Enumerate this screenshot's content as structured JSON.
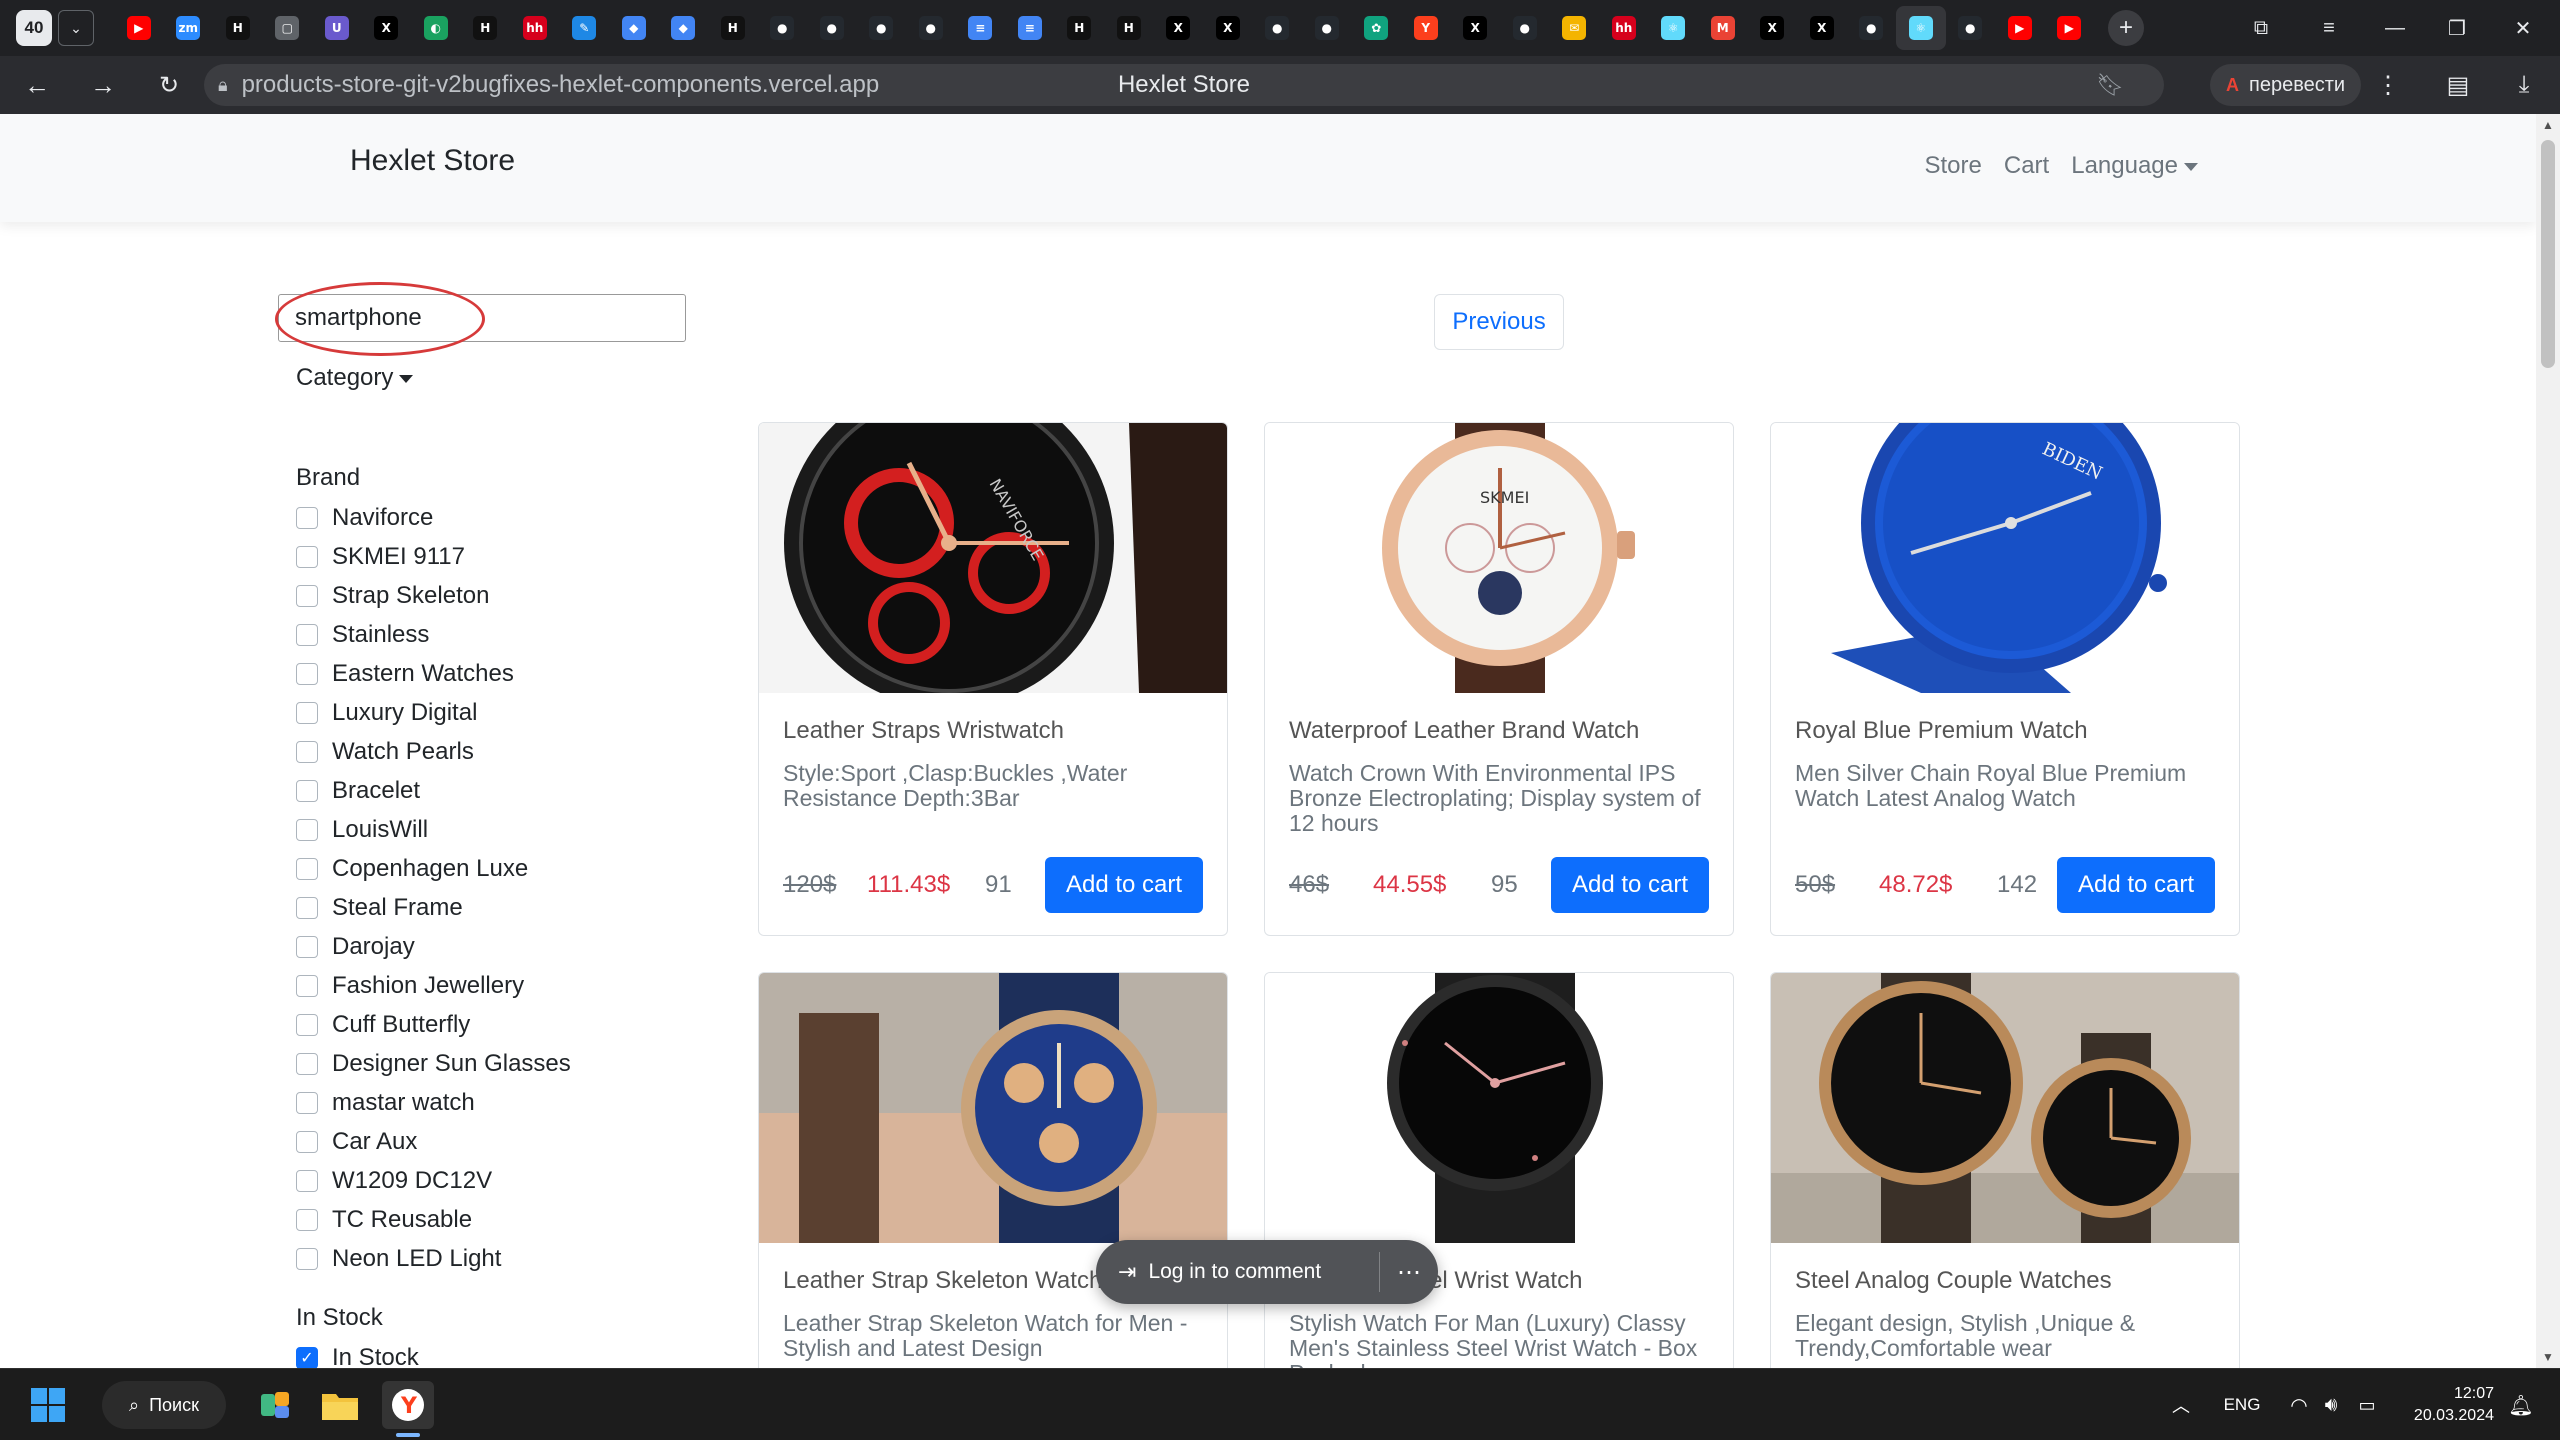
{
  "browser": {
    "tab_count": "40",
    "tabs": [
      {
        "icon": "youtube-icon",
        "glyph": "▶",
        "color": "#ff0000"
      },
      {
        "icon": "zoom-icon",
        "glyph": "zm",
        "color": "#2d8cff"
      },
      {
        "icon": "hexlet-icon",
        "glyph": "H",
        "color": "#111111"
      },
      {
        "icon": "document-icon",
        "glyph": "▢",
        "color": "#5f6368"
      },
      {
        "icon": "uchi-icon",
        "glyph": "U",
        "color": "#6a5acd"
      },
      {
        "icon": "x-icon",
        "glyph": "X",
        "color": "#000000"
      },
      {
        "icon": "green-bird-icon",
        "glyph": "◐",
        "color": "#1aa260"
      },
      {
        "icon": "hexlet-icon",
        "glyph": "H",
        "color": "#111111"
      },
      {
        "icon": "hh-icon",
        "glyph": "hh",
        "color": "#d6001c"
      },
      {
        "icon": "feather-icon",
        "glyph": "✎",
        "color": "#1e88e5"
      },
      {
        "icon": "cube-icon",
        "glyph": "◆",
        "color": "#4285f4"
      },
      {
        "icon": "cube-icon",
        "glyph": "◆",
        "color": "#4285f4"
      },
      {
        "icon": "hexlet-icon",
        "glyph": "H",
        "color": "#111111"
      },
      {
        "icon": "github-icon",
        "glyph": "●",
        "color": "#24292f"
      },
      {
        "icon": "github-icon",
        "glyph": "●",
        "color": "#24292f"
      },
      {
        "icon": "github-icon",
        "glyph": "●",
        "color": "#24292f"
      },
      {
        "icon": "github-icon",
        "glyph": "●",
        "color": "#24292f"
      },
      {
        "icon": "docs-icon",
        "glyph": "≡",
        "color": "#4285f4"
      },
      {
        "icon": "docs-icon",
        "glyph": "≡",
        "color": "#4285f4"
      },
      {
        "icon": "hexlet-icon",
        "glyph": "H",
        "color": "#111111"
      },
      {
        "icon": "hexlet-icon",
        "glyph": "H",
        "color": "#111111"
      },
      {
        "icon": "x-icon",
        "glyph": "X",
        "color": "#000000"
      },
      {
        "icon": "x-icon",
        "glyph": "X",
        "color": "#000000"
      },
      {
        "icon": "github-icon",
        "glyph": "●",
        "color": "#24292f"
      },
      {
        "icon": "github-icon",
        "glyph": "●",
        "color": "#24292f"
      },
      {
        "icon": "chatgpt-icon",
        "glyph": "✿",
        "color": "#10a37f"
      },
      {
        "icon": "yandex-icon",
        "glyph": "Y",
        "color": "#fc3f1d"
      },
      {
        "icon": "x-icon",
        "glyph": "X",
        "color": "#000000"
      },
      {
        "icon": "github-icon",
        "glyph": "●",
        "color": "#24292f"
      },
      {
        "icon": "mail-icon",
        "glyph": "✉",
        "color": "#f4b400"
      },
      {
        "icon": "hh-icon",
        "glyph": "hh",
        "color": "#d6001c"
      },
      {
        "icon": "react-icon",
        "glyph": "⚛",
        "color": "#61dafb"
      },
      {
        "icon": "gmail-icon",
        "glyph": "M",
        "color": "#ea4335"
      },
      {
        "icon": "x-icon",
        "glyph": "X",
        "color": "#000000"
      },
      {
        "icon": "x-icon",
        "glyph": "X",
        "color": "#000000"
      },
      {
        "icon": "github-icon",
        "glyph": "●",
        "color": "#24292f"
      },
      {
        "icon": "react-icon",
        "glyph": "⚛",
        "color": "#61dafb",
        "active": true
      },
      {
        "icon": "github-icon",
        "glyph": "●",
        "color": "#24292f"
      },
      {
        "icon": "youtube-icon",
        "glyph": "▶",
        "color": "#ff0000"
      },
      {
        "icon": "youtube-icon",
        "glyph": "▶",
        "color": "#ff0000"
      }
    ],
    "url": "products-store-git-v2bugfixes-hexlet-components.vercel.app",
    "page_title": "Hexlet Store",
    "translate_label": "перевести"
  },
  "navbar": {
    "brand": "Hexlet Store",
    "links": [
      "Store",
      "Cart"
    ],
    "language_label": "Language"
  },
  "search": {
    "value": "smartphone"
  },
  "sidebar": {
    "category_label": "Category",
    "brand_heading": "Brand",
    "brands": [
      "Naviforce",
      "SKMEI 9117",
      "Strap Skeleton",
      "Stainless",
      "Eastern Watches",
      "Luxury Digital",
      "Watch Pearls",
      "Bracelet",
      "LouisWill",
      "Copenhagen Luxe",
      "Steal Frame",
      "Darojay",
      "Fashion Jewellery",
      "Cuff Butterfly",
      "Designer Sun Glasses",
      "mastar watch",
      "Car Aux",
      "W1209 DC12V",
      "TC Reusable",
      "Neon LED Light"
    ],
    "in_stock_heading": "In Stock",
    "in_stock_label": "In Stock",
    "in_stock_checked": true
  },
  "pagination": {
    "previous_label": "Previous"
  },
  "products": [
    {
      "title": "Leather Straps Wristwatch",
      "description": "Style:Sport ,Clasp:Buckles ,Water Resistance Depth:3Bar",
      "old_price": "120$",
      "price": "111.43$",
      "stock": "91",
      "button": "Add to cart",
      "image": "watch-black-red"
    },
    {
      "title": "Waterproof Leather Brand Watch",
      "description": "Watch Crown With Environmental IPS Bronze Electroplating; Display system of 12 hours",
      "old_price": "46$",
      "price": "44.55$",
      "stock": "95",
      "button": "Add to cart",
      "image": "watch-silver-rose"
    },
    {
      "title": "Royal Blue Premium Watch",
      "description": "Men Silver Chain Royal Blue Premium Watch Latest Analog Watch",
      "old_price": "50$",
      "price": "48.72$",
      "stock": "142",
      "button": "Add to cart",
      "image": "watch-royal-blue"
    },
    {
      "title": "Leather Strap Skeleton Watch",
      "description": "Leather Strap Skeleton Watch for Men - Stylish and Latest Design",
      "image": "watch-skeleton-blue"
    },
    {
      "title": "Stainless Steel Wrist Watch",
      "description": "Stylish Watch For Man (Luxury) Classy Men's Stainless Steel Wrist Watch - Box Packed",
      "image": "watch-black-steel"
    },
    {
      "title": "Steel Analog Couple Watches",
      "description": "Elegant design, Stylish ,Unique & Trendy,Comfortable wear",
      "image": "watch-couple-gold"
    }
  ],
  "overlay": {
    "comment_label": "Log in to comment"
  },
  "taskbar": {
    "search_label": "Поиск",
    "language": "ENG",
    "time": "12:07",
    "date": "20.03.2024"
  }
}
